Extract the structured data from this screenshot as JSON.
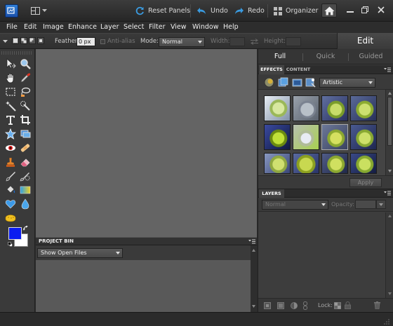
{
  "titlebar": {
    "reset_panels": "Reset Panels",
    "undo": "Undo",
    "redo": "Redo",
    "organizer": "Organizer"
  },
  "menu": [
    "File",
    "Edit",
    "Image",
    "Enhance",
    "Layer",
    "Select",
    "Filter",
    "View",
    "Window",
    "Help"
  ],
  "options": {
    "feather_label": "Feather:",
    "feather_value": "0 px",
    "antialias_label": "Anti-alias",
    "mode_label": "Mode:",
    "mode_value": "Normal",
    "width_label": "Width:",
    "height_label": "Height:"
  },
  "edit_mode": "Edit",
  "mode_tabs": [
    "Full",
    "Quick",
    "Guided"
  ],
  "effects": {
    "tabs": [
      "EFFECTS",
      "CONTENT"
    ],
    "category": "Artistic",
    "apply_label": "Apply"
  },
  "layers": {
    "title": "LAYERS",
    "blend_mode": "Normal",
    "opacity_label": "Opacity:",
    "lock_label": "Lock:"
  },
  "project_bin": {
    "title": "PROJECT BIN",
    "dropdown": "Show Open Files"
  },
  "colors": {
    "foreground": "#0a1cf0",
    "background": "#ffffff",
    "accent_blue": "#3a8fd8"
  }
}
